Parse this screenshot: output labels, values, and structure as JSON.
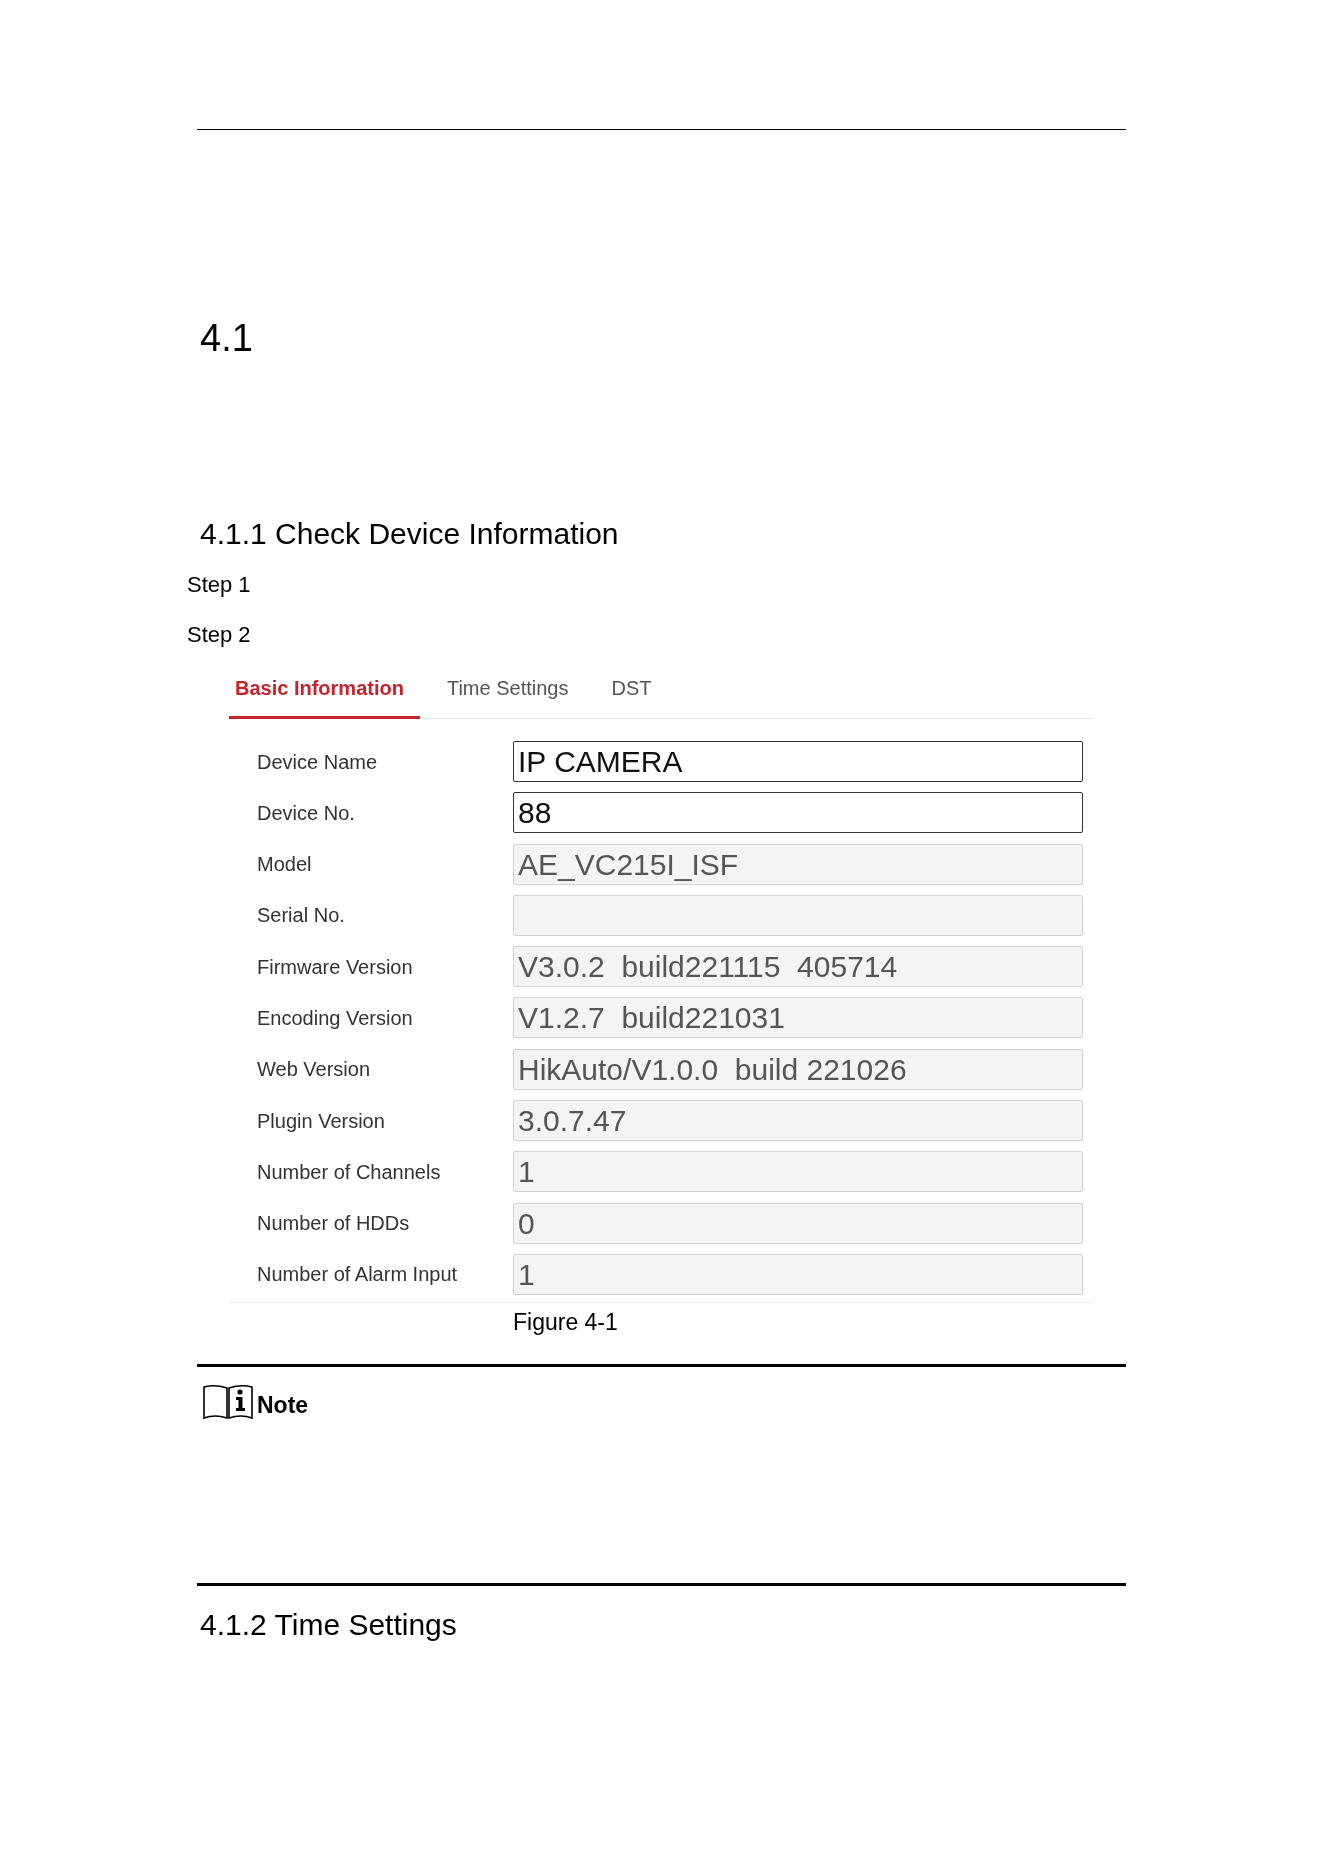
{
  "section": {
    "number": "4.1"
  },
  "subsection": {
    "title": "4.1.1 Check Device Information"
  },
  "steps": [
    {
      "label": "Step 1"
    },
    {
      "label": "Step 2"
    }
  ],
  "figure": {
    "tabs": [
      {
        "label": "Basic Information",
        "selected": true
      },
      {
        "label": "Time Settings",
        "selected": false
      },
      {
        "label": "DST",
        "selected": false
      }
    ],
    "fields": [
      {
        "label": "Device Name",
        "value": "IP CAMERA",
        "disabled": false
      },
      {
        "label": "Device No.",
        "value": "88",
        "disabled": false
      },
      {
        "label": "Model",
        "value": "AE_VC215I_ISF",
        "disabled": true
      },
      {
        "label": "Serial No.",
        "disabled": true
      },
      {
        "label": "Firmware Version",
        "value": "V3.0.2  build221115  405714",
        "disabled": true
      },
      {
        "label": "Encoding Version",
        "value": "V1.2.7  build221031",
        "disabled": true
      },
      {
        "label": "Web Version",
        "value": "HikAuto/V1.0.0  build 221026",
        "disabled": true
      },
      {
        "label": "Plugin Version",
        "value": "3.0.7.47",
        "disabled": true
      },
      {
        "label": "Number of Channels",
        "value": "1",
        "disabled": true
      },
      {
        "label": "Number of HDDs",
        "value": "0",
        "disabled": true
      },
      {
        "label": "Number of Alarm Input",
        "value": "1",
        "disabled": true
      }
    ],
    "caption": "Figure 4-1"
  },
  "note": {
    "title": "Note"
  },
  "next_subsection": {
    "title": "4.1.2 Time Settings"
  }
}
